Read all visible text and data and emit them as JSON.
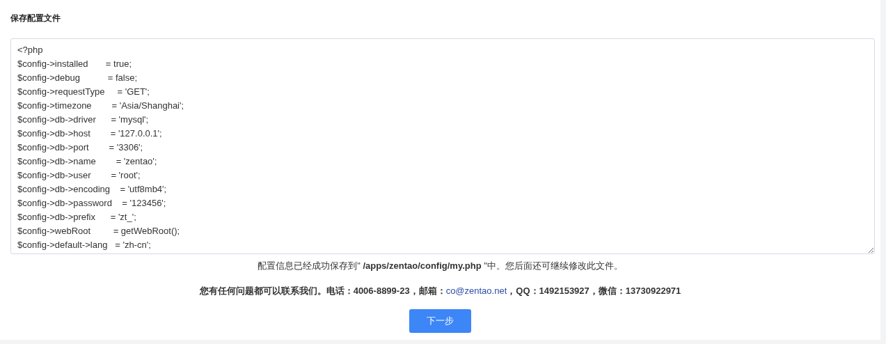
{
  "title": "保存配置文件",
  "config_lines": [
    "<?php",
    "$config->installed       = true;",
    "$config->debug           = false;",
    "$config->requestType     = 'GET';",
    "$config->timezone        = 'Asia/Shanghai';",
    "$config->db->driver      = 'mysql';",
    "$config->db->host        = '127.0.0.1';",
    "$config->db->port        = '3306';",
    "$config->db->name        = 'zentao';",
    "$config->db->user        = 'root';",
    "$config->db->encoding    = 'utf8mb4';",
    "$config->db->password    = '123456';",
    "$config->db->prefix      = 'zt_';",
    "$config->webRoot         = getWebRoot();",
    "$config->default->lang   = 'zh-cn';"
  ],
  "saved_message": "配置信息已经成功保存到\" **/apps/zentao/config/my.php** \"中。您后面还可继续修改此文件。",
  "contact": {
    "before": "您有任何问题都可以联系我们。电话：4006-8899-23，邮箱：",
    "email": "co@zentao.net",
    "after": "，QQ：1492153927，微信：13730922971"
  },
  "next_button": "下一步"
}
